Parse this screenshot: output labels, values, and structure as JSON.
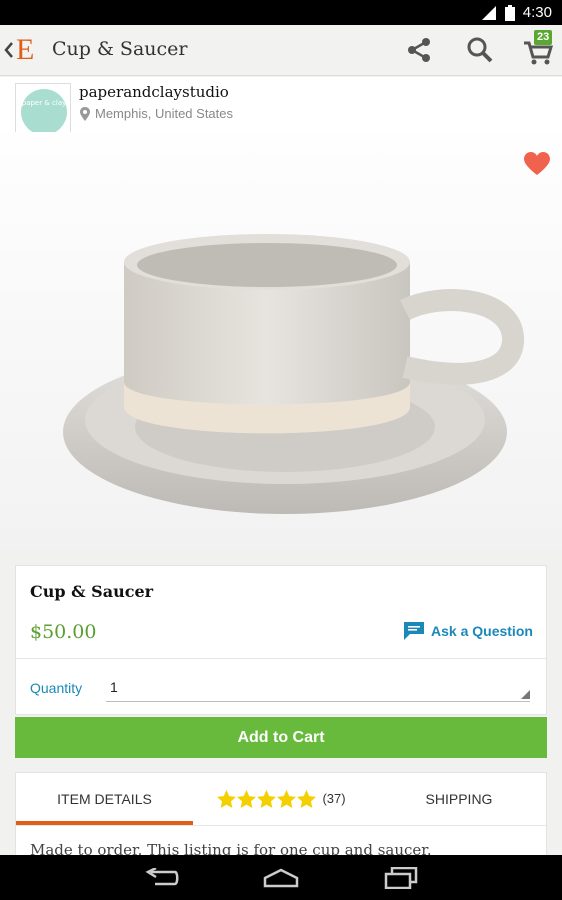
{
  "status_bar": {
    "time": "4:30"
  },
  "app_bar": {
    "logo": "E",
    "title": "Cup & Saucer",
    "cart_count": "23"
  },
  "shop": {
    "name": "paperandclaystudio",
    "location": "Memphis, United States",
    "avatar_text": "paper & clay"
  },
  "listing": {
    "title": "Cup & Saucer",
    "price": "$50.00",
    "favorited": true,
    "ask_question_label": "Ask a Question",
    "quantity_label": "Quantity",
    "quantity_value": "1",
    "add_to_cart_label": "Add to Cart"
  },
  "tabs": {
    "item_details": "ITEM DETAILS",
    "reviews_count": "(37)",
    "rating_stars": 5,
    "shipping": "SHIPPING",
    "active": "item_details"
  },
  "description": "Made to order. This listing is for one cup and saucer.",
  "colors": {
    "brand_orange": "#e05d1a",
    "price_green": "#5a9e2f",
    "button_green": "#68ba3c",
    "link_blue": "#1c88b8",
    "heart_red": "#f0624d",
    "star_yellow": "#f5d000"
  },
  "icons": {
    "share": "share-icon",
    "search": "search-icon",
    "cart": "cart-icon",
    "heart": "heart-icon",
    "ask": "speech-bubble-icon",
    "location": "map-pin-icon"
  }
}
